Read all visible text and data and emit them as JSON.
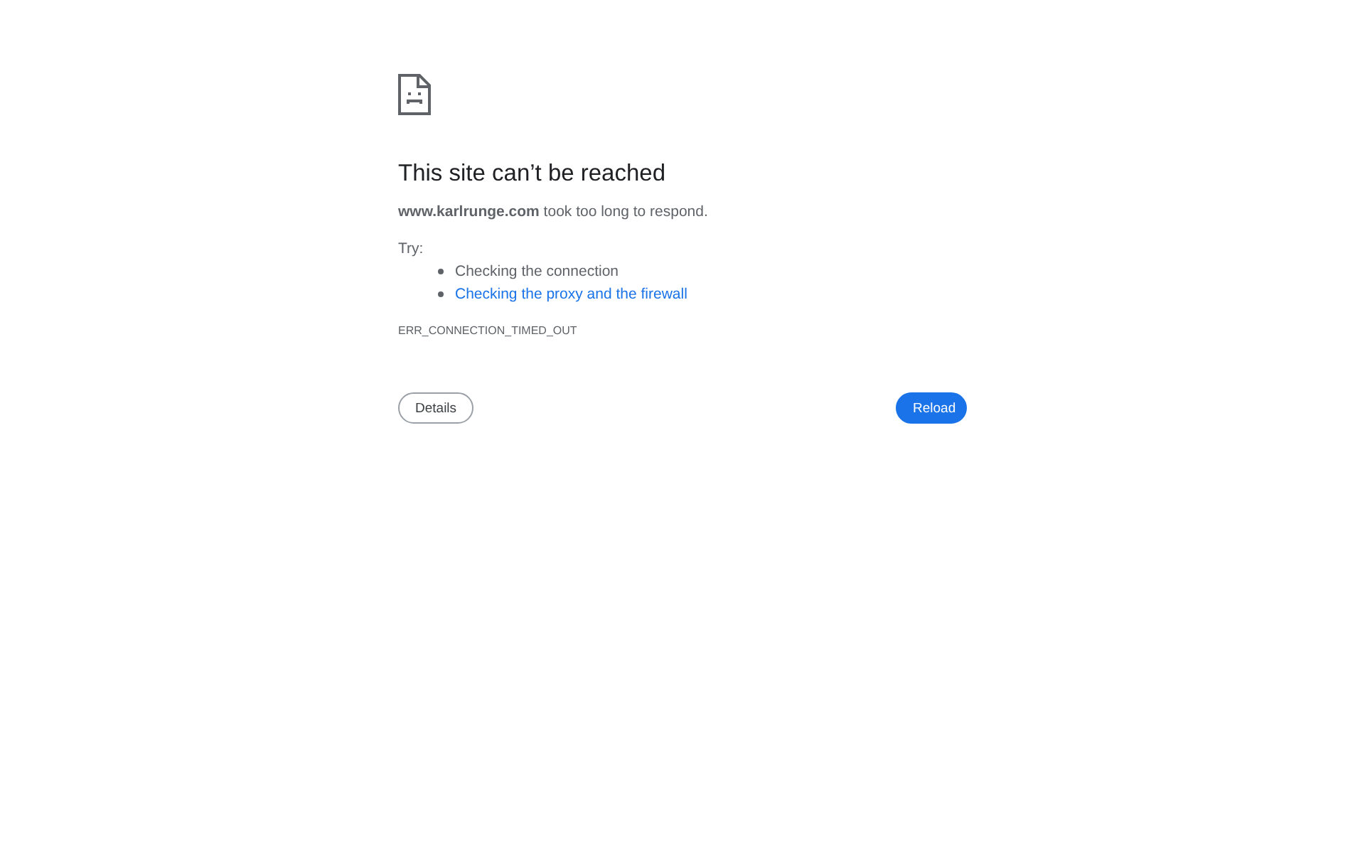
{
  "title": "This site can’t be reached",
  "message": "**www.karlrunge.com** took too long to respond.",
  "suggestions": {
    "heading": "Try:",
    "items": [
      {
        "kind": "text",
        "label": "Checking the connection"
      },
      {
        "kind": "link",
        "label": "Checking the proxy and the firewall"
      }
    ]
  },
  "error_code": "ERR_CONNECTION_TIMED_OUT",
  "buttons": [
    {
      "kind": "secondary",
      "label": "Details"
    },
    {
      "kind": "primary",
      "label": "Reload"
    }
  ]
}
